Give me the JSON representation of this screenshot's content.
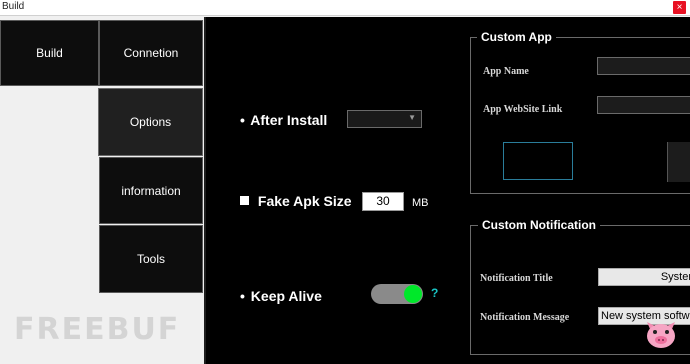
{
  "window": {
    "title": "Build",
    "close_glyph": "×"
  },
  "nav": {
    "build": "Build",
    "connection": "Connetion",
    "options": "Options",
    "information": "information",
    "tools": "Tools"
  },
  "options": {
    "after_install_label": "After Install",
    "after_install_value": "",
    "fake_apk_label": "Fake Apk Size",
    "fake_apk_value": "30",
    "fake_apk_unit": "MB",
    "keep_alive_label": "Keep Alive",
    "keep_alive_on": true,
    "help_glyph": "?"
  },
  "custom_app": {
    "title": "Custom App",
    "app_name_label": "App Name",
    "app_name_value": "",
    "website_label": "App WebSite Link",
    "website_value": ""
  },
  "custom_notification": {
    "title": "Custom Notification",
    "notif_title_label": "Notification Title",
    "notif_title_value": "Syster",
    "notif_msg_label": "Notification Message",
    "notif_msg_value": "New system softw"
  },
  "watermark": "FREEBUF",
  "colors": {
    "toggle_on": "#00e82a",
    "help": "#19c4c4",
    "close": "#e81123"
  }
}
